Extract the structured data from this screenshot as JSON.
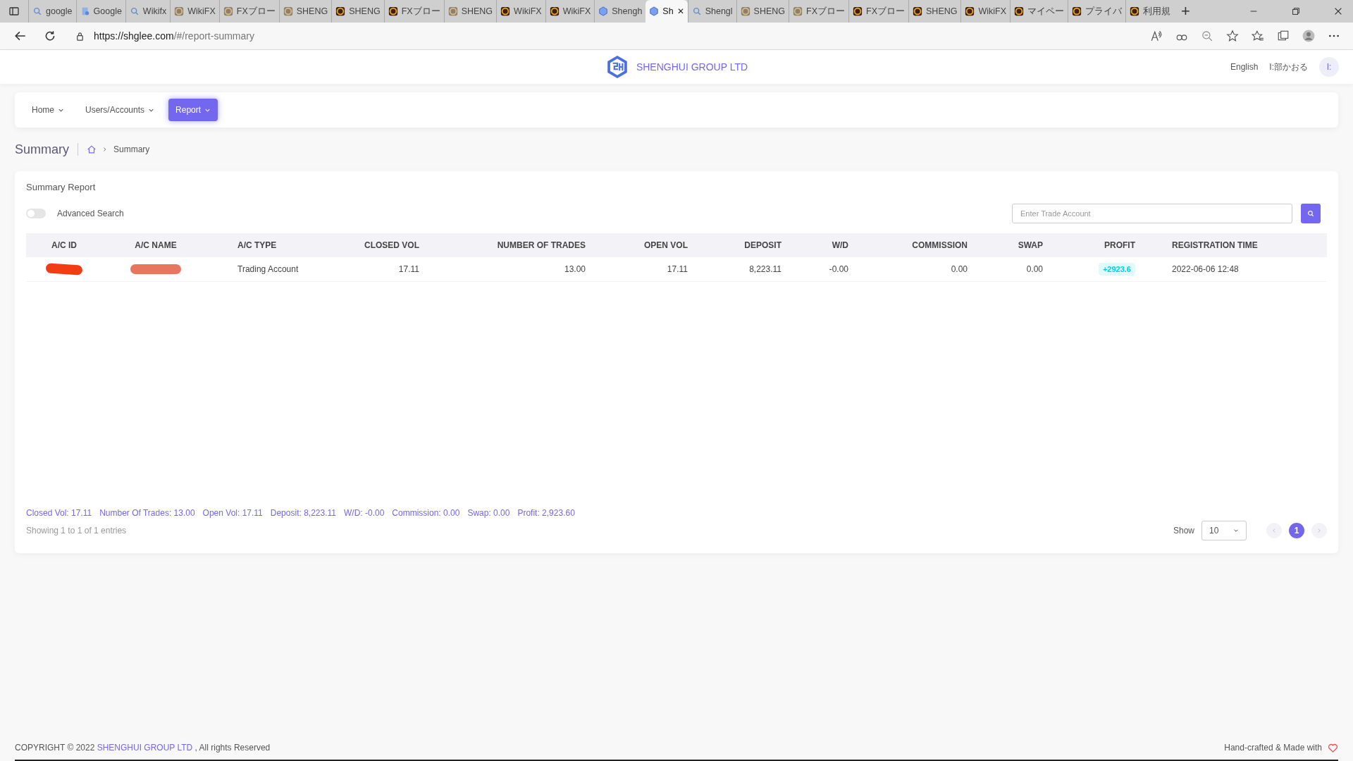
{
  "browser": {
    "tabs": [
      {
        "title": "google",
        "kind": "search",
        "selected": false
      },
      {
        "title": "Google",
        "kind": "doc",
        "selected": false
      },
      {
        "title": "Wikifx",
        "kind": "search",
        "selected": false
      },
      {
        "title": "WikiFX",
        "kind": "faded",
        "selected": false
      },
      {
        "title": "FXブロー",
        "kind": "faded",
        "selected": false
      },
      {
        "title": "SHENG",
        "kind": "faded",
        "selected": false
      },
      {
        "title": "SHENG",
        "kind": "brand",
        "selected": false
      },
      {
        "title": "FXブロー",
        "kind": "brand",
        "selected": false
      },
      {
        "title": "SHENG",
        "kind": "faded",
        "selected": false
      },
      {
        "title": "WikiFX",
        "kind": "brand",
        "selected": false
      },
      {
        "title": "WikiFX",
        "kind": "brand",
        "selected": false
      },
      {
        "title": "Shengh",
        "kind": "cube",
        "selected": false
      },
      {
        "title": "Sh",
        "kind": "cube",
        "selected": true
      },
      {
        "title": "Shengl",
        "kind": "search",
        "selected": false
      },
      {
        "title": "SHENG",
        "kind": "faded",
        "selected": false
      },
      {
        "title": "FXブロー",
        "kind": "faded",
        "selected": false
      },
      {
        "title": "FXブロー",
        "kind": "brand",
        "selected": false
      },
      {
        "title": "SHENG",
        "kind": "brand",
        "selected": false
      },
      {
        "title": "WikiFX",
        "kind": "brand",
        "selected": false
      },
      {
        "title": "マイペー",
        "kind": "brand",
        "selected": false
      },
      {
        "title": "プライバ",
        "kind": "brand",
        "selected": false
      },
      {
        "title": "利用規",
        "kind": "brand",
        "selected": false
      }
    ],
    "close_tab": "✕",
    "new_tab": "+",
    "url_host": "https://shglee.com",
    "url_path": "/#/report-summary"
  },
  "header": {
    "brand": "SHENGHUI GROUP LTD",
    "language": "English",
    "user": "I:部かおる",
    "avatar": "I:"
  },
  "nav": [
    {
      "label": "Home",
      "selected": false
    },
    {
      "label": "Users/Accounts",
      "selected": false
    },
    {
      "label": "Report",
      "selected": true
    }
  ],
  "page_title": "Summary",
  "breadcrumb": "Summary",
  "card": {
    "title": "Summary Report",
    "advanced_search": {
      "label": "Advanced Search",
      "on": false
    },
    "search": {
      "placeholder": "Enter Trade Account"
    },
    "table": {
      "columns": [
        {
          "label": "A/C ID"
        },
        {
          "label": "A/C NAME"
        },
        {
          "label": "A/C TYPE"
        },
        {
          "label": "CLOSED VOL"
        },
        {
          "label": "NUMBER OF TRADES"
        },
        {
          "label": "OPEN VOL"
        },
        {
          "label": "DEPOSIT"
        },
        {
          "label": "W/D"
        },
        {
          "label": "COMMISSION"
        },
        {
          "label": "SWAP"
        },
        {
          "label": "PROFIT"
        },
        {
          "label": "REGISTRATION TIME"
        }
      ],
      "rows": [
        {
          "cells": [
            {
              "kind": "redacted"
            },
            {
              "kind": "redacted"
            },
            {
              "kind": "text",
              "text": "Trading Account"
            },
            {
              "kind": "text",
              "text": "17.11"
            },
            {
              "kind": "text",
              "text": "13.00"
            },
            {
              "kind": "text",
              "text": "17.11"
            },
            {
              "kind": "text",
              "text": "8,223.11"
            },
            {
              "kind": "text",
              "text": "-0.00"
            },
            {
              "kind": "text",
              "text": "0.00"
            },
            {
              "kind": "text",
              "text": "0.00"
            },
            {
              "kind": "badge",
              "text": "+2923.6"
            },
            {
              "kind": "text",
              "text": "2022-06-06 12:48"
            }
          ]
        }
      ]
    },
    "totals": [
      "Closed Vol: 17.11",
      "Number Of Trades: 13.00",
      "Open Vol: 17.11",
      "Deposit: 8,223.11",
      "W/D: -0.00",
      "Commission: 0.00",
      "Swap: 0.00",
      "Profit: 2,923.60"
    ],
    "entries": "Showing 1 to 1 of 1 entries",
    "show_label": "Show",
    "page_size": "10",
    "pages": [
      {
        "label": "1",
        "selected": true
      }
    ]
  },
  "footer": {
    "copyright": "COPYRIGHT © 2022",
    "company": "SHENGHUI GROUP LTD",
    "rights": ", All rights Reserved",
    "made_with": "Hand-crafted & Made with"
  }
}
